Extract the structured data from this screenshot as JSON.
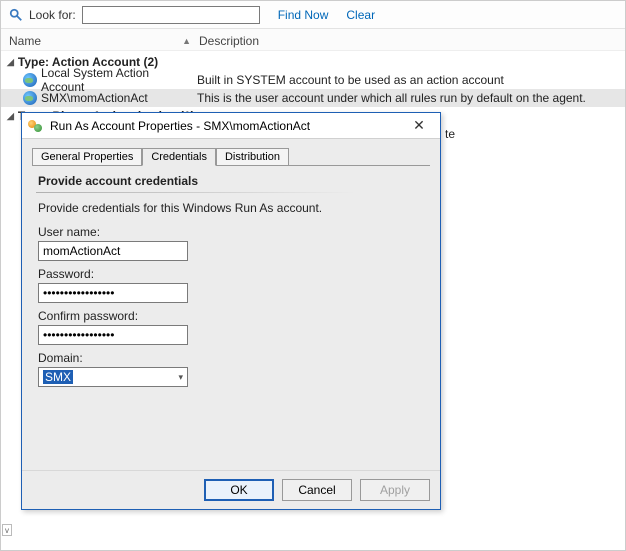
{
  "toolbar": {
    "look_for_label": "Look for:",
    "search_value": "",
    "find_now": "Find Now",
    "clear": "Clear"
  },
  "columns": {
    "name": "Name",
    "description": "Description"
  },
  "groups": [
    {
      "label": "Type: Action Account (2)",
      "items": [
        {
          "name": "Local System Action Account",
          "description": "Built in SYSTEM account to be used as an action account",
          "selected": false
        },
        {
          "name": "SMX\\momActionAct",
          "description": "This is the user account under which all rules run by default on the agent.",
          "selected": true
        }
      ]
    },
    {
      "label": "Type: Binary Authentication (1)",
      "items": []
    }
  ],
  "hidden_row_tail": "te",
  "dialog": {
    "title": "Run As Account Properties - SMX\\momActionAct",
    "tabs": {
      "general": "General Properties",
      "credentials": "Credentials",
      "distribution": "Distribution"
    },
    "section_title": "Provide account credentials",
    "intro": "Provide credentials for this Windows Run As account.",
    "fields": {
      "username_label": "User name:",
      "username_value": "momActionAct",
      "password_label": "Password:",
      "password_value": "•••••••••••••••••",
      "confirm_label": "Confirm password:",
      "confirm_value": "•••••••••••••••••",
      "domain_label": "Domain:",
      "domain_value": "SMX"
    },
    "buttons": {
      "ok": "OK",
      "cancel": "Cancel",
      "apply": "Apply"
    }
  }
}
